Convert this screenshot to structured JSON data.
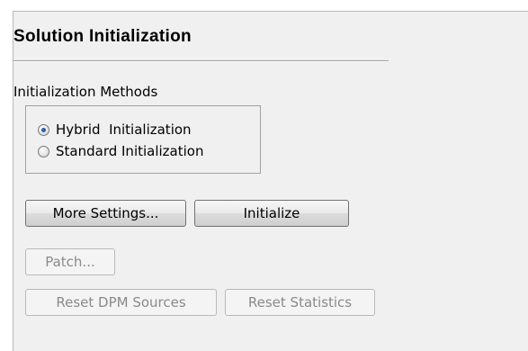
{
  "panel": {
    "title": "Solution Initialization"
  },
  "methods": {
    "label": "Initialization Methods",
    "options": [
      {
        "label": "Hybrid  Initialization",
        "selected": true
      },
      {
        "label": "Standard Initialization",
        "selected": false
      }
    ]
  },
  "buttons": {
    "more_settings": "More Settings...",
    "initialize": "Initialize",
    "patch": "Patch...",
    "reset_dpm": "Reset DPM Sources",
    "reset_statistics": "Reset Statistics"
  }
}
